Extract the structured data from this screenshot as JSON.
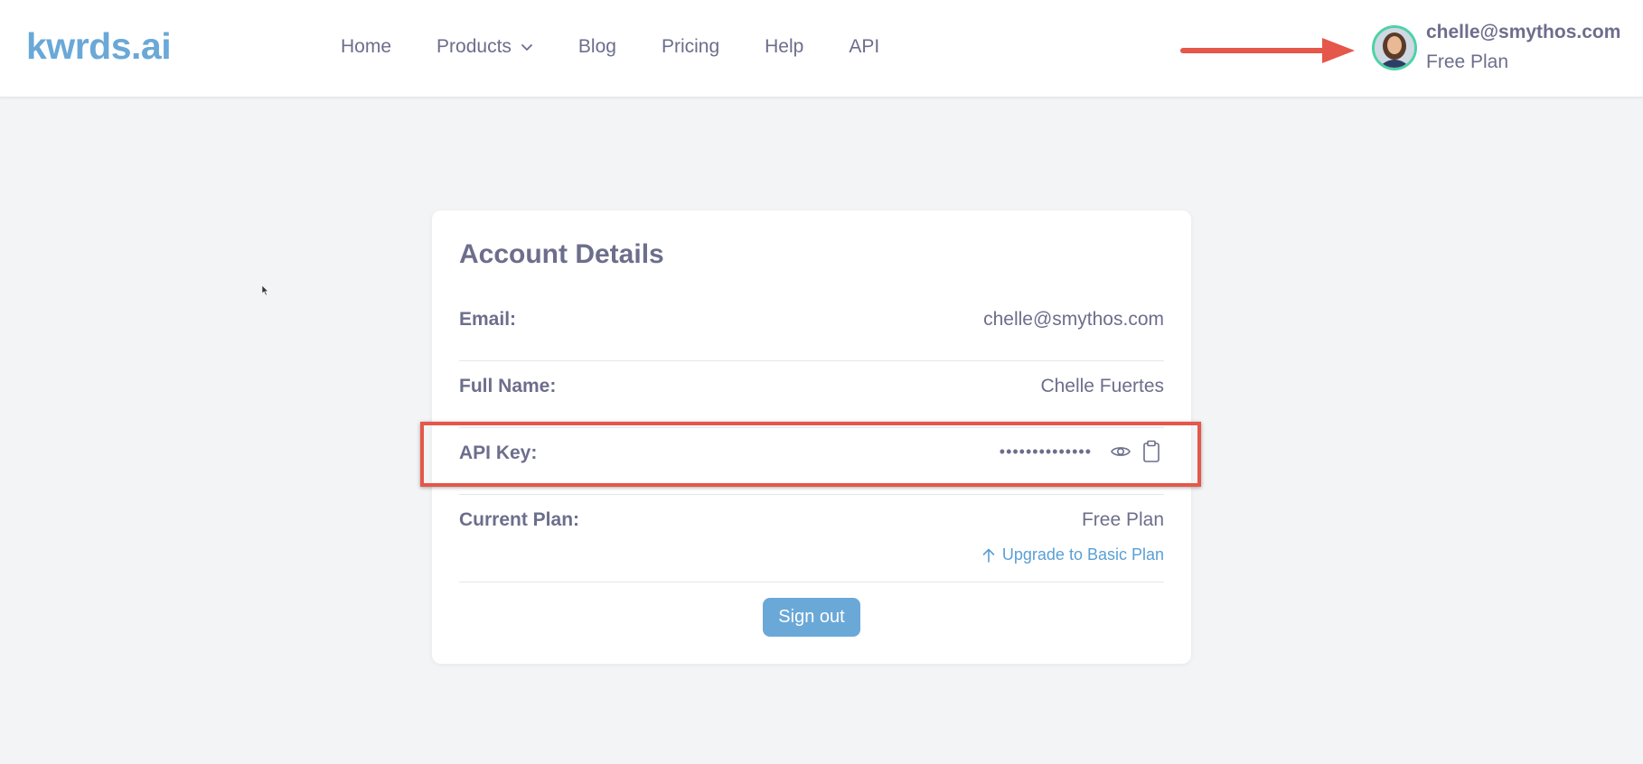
{
  "brand": {
    "logo_text": "kwrds.ai",
    "accent": "#6aa8d8"
  },
  "nav": {
    "items": [
      {
        "label": "Home"
      },
      {
        "label": "Products",
        "has_dropdown": true
      },
      {
        "label": "Blog"
      },
      {
        "label": "Pricing"
      },
      {
        "label": "Help"
      },
      {
        "label": "API"
      }
    ]
  },
  "user": {
    "email": "chelle@smythos.com",
    "plan": "Free Plan"
  },
  "account": {
    "title": "Account Details",
    "email_label": "Email:",
    "email_value": "chelle@smythos.com",
    "name_label": "Full Name:",
    "name_value": "Chelle Fuertes",
    "api_label": "API Key:",
    "api_masked": "••••••••••••••",
    "plan_label": "Current Plan:",
    "plan_value": "Free Plan",
    "upgrade_label": "Upgrade to Basic Plan",
    "signout_label": "Sign out"
  },
  "annotations": {
    "highlight_color": "#e4574a"
  },
  "icons": [
    "chevron-down-icon",
    "eye-icon",
    "clipboard-icon",
    "arrow-up-icon",
    "pointer-cursor-icon"
  ]
}
